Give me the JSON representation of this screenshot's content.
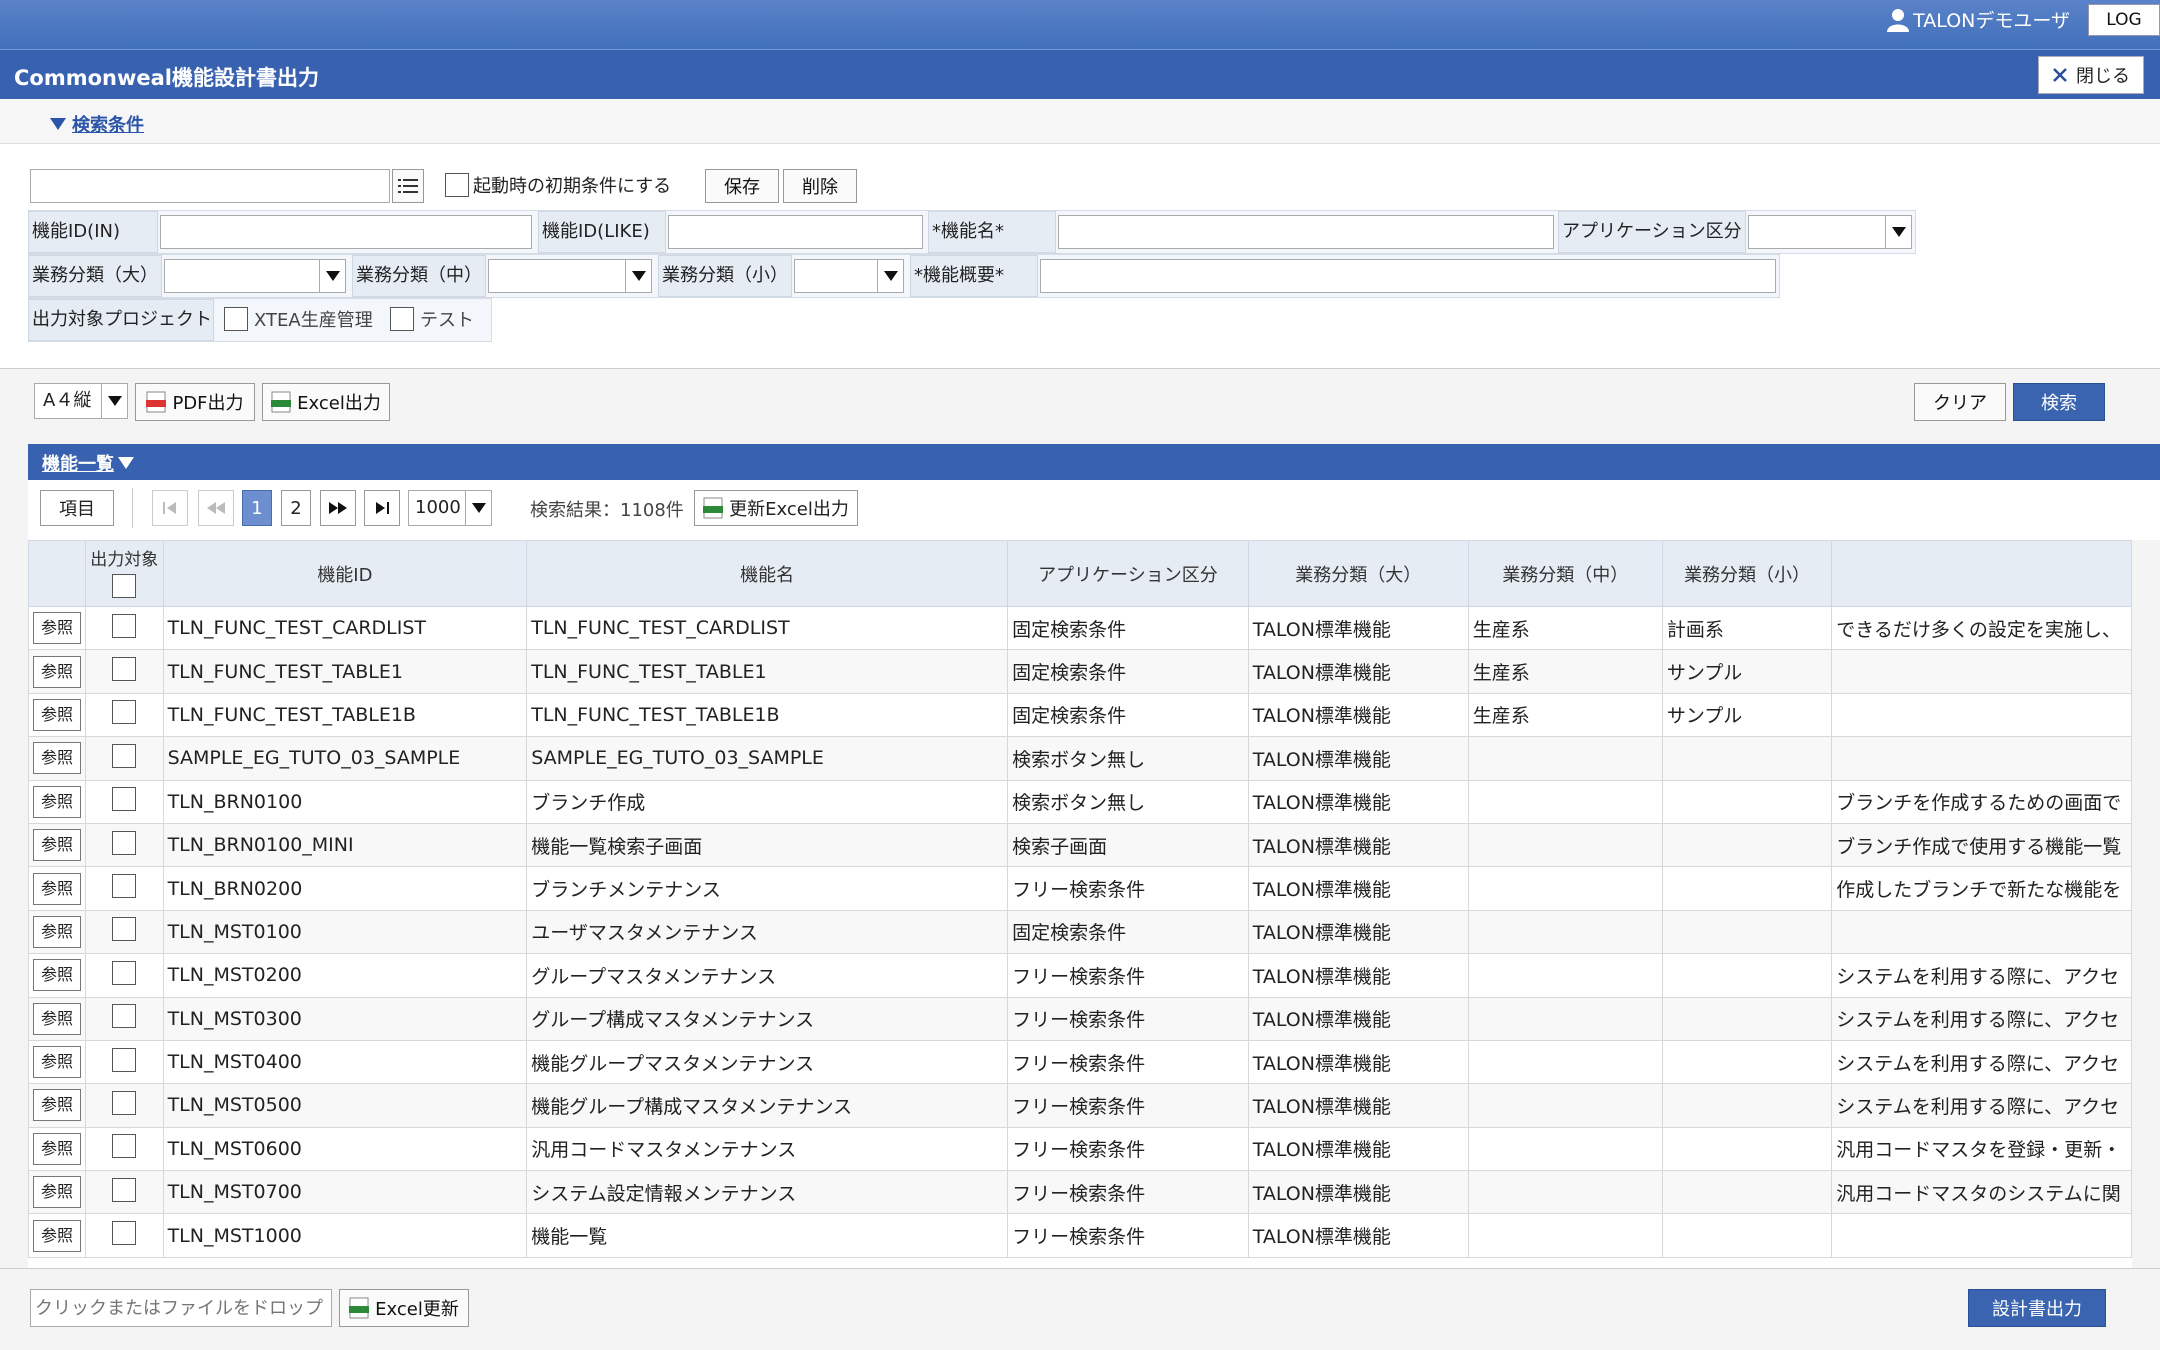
{
  "header": {
    "user_name": "TALONデモユーザ",
    "log_label": "LOG"
  },
  "window": {
    "title": "Commonweal機能設計書出力",
    "close_label": "閉じる"
  },
  "search_conditions": {
    "toggle_label": "検索条件",
    "preset_value": "",
    "initial_condition_label": "起動時の初期条件にする",
    "save_label": "保存",
    "delete_label": "削除",
    "fields": {
      "func_id_in": "機能ID(IN)",
      "func_id_like": "機能ID(LIKE)",
      "func_name": "*機能名*",
      "app_category": "アプリケーション区分",
      "biz_large": "業務分類（大）",
      "biz_medium": "業務分類（中）",
      "biz_small": "業務分類（小）",
      "func_summary": "*機能概要*",
      "output_project": "出力対象プロジェクト"
    },
    "projects": [
      "XTEA生産管理",
      "テスト"
    ]
  },
  "toolbar": {
    "paper_size": "A４縦",
    "pdf_label": "PDF出力",
    "excel_label": "Excel出力",
    "clear_label": "クリア",
    "search_label": "検索"
  },
  "list": {
    "title": "機能一覧",
    "items_label": "項目",
    "pages": [
      "1",
      "2"
    ],
    "page_size": "1000",
    "result_text": "検索結果：1108件",
    "update_excel_label": "更新Excel出力",
    "columns": {
      "output_target": "出力対象",
      "func_id": "機能ID",
      "func_name": "機能名",
      "app_category": "アプリケーション区分",
      "biz_large": "業務分類（大）",
      "biz_medium": "業務分類（中）",
      "biz_small": "業務分類（小）"
    },
    "ref_label": "参照",
    "rows": [
      [
        "TLN_FUNC_TEST_CARDLIST",
        "TLN_FUNC_TEST_CARDLIST",
        "固定検索条件",
        "TALON標準機能",
        "生産系",
        "計画系",
        "できるだけ多くの設定を実施し、"
      ],
      [
        "TLN_FUNC_TEST_TABLE1",
        "TLN_FUNC_TEST_TABLE1",
        "固定検索条件",
        "TALON標準機能",
        "生産系",
        "サンプル",
        ""
      ],
      [
        "TLN_FUNC_TEST_TABLE1B",
        "TLN_FUNC_TEST_TABLE1B",
        "固定検索条件",
        "TALON標準機能",
        "生産系",
        "サンプル",
        ""
      ],
      [
        "SAMPLE_EG_TUTO_03_SAMPLE",
        "SAMPLE_EG_TUTO_03_SAMPLE",
        "検索ボタン無し",
        "TALON標準機能",
        "",
        "",
        ""
      ],
      [
        "TLN_BRN0100",
        "ブランチ作成",
        "検索ボタン無し",
        "TALON標準機能",
        "",
        "",
        "ブランチを作成するための画面で"
      ],
      [
        "TLN_BRN0100_MINI",
        "機能一覧検索子画面",
        "検索子画面",
        "TALON標準機能",
        "",
        "",
        "ブランチ作成で使用する機能一覧"
      ],
      [
        "TLN_BRN0200",
        "ブランチメンテナンス",
        "フリー検索条件",
        "TALON標準機能",
        "",
        "",
        "作成したブランチで新たな機能を"
      ],
      [
        "TLN_MST0100",
        "ユーザマスタメンテナンス",
        "固定検索条件",
        "TALON標準機能",
        "",
        "",
        ""
      ],
      [
        "TLN_MST0200",
        "グループマスタメンテナンス",
        "フリー検索条件",
        "TALON標準機能",
        "",
        "",
        "システムを利用する際に、アクセ"
      ],
      [
        "TLN_MST0300",
        "グループ構成マスタメンテナンス",
        "フリー検索条件",
        "TALON標準機能",
        "",
        "",
        "システムを利用する際に、アクセ"
      ],
      [
        "TLN_MST0400",
        "機能グループマスタメンテナンス",
        "フリー検索条件",
        "TALON標準機能",
        "",
        "",
        "システムを利用する際に、アクセ"
      ],
      [
        "TLN_MST0500",
        "機能グループ構成マスタメンテナンス",
        "フリー検索条件",
        "TALON標準機能",
        "",
        "",
        "システムを利用する際に、アクセ"
      ],
      [
        "TLN_MST0600",
        "汎用コードマスタメンテナンス",
        "フリー検索条件",
        "TALON標準機能",
        "",
        "",
        "汎用コードマスタを登録・更新・"
      ],
      [
        "TLN_MST0700",
        "システム設定情報メンテナンス",
        "フリー検索条件",
        "TALON標準機能",
        "",
        "",
        "汎用コードマスタのシステムに関"
      ],
      [
        "TLN_MST1000",
        "機能一覧",
        "フリー検索条件",
        "TALON標準機能",
        "",
        "",
        ""
      ]
    ]
  },
  "footer": {
    "file_drop_placeholder": "クリックまたはファイルをドロップ",
    "excel_update_label": "Excel更新",
    "design_output_label": "設計書出力"
  },
  "colors": {
    "header_blue": "#3862b0",
    "primary_button": "#3a63b0",
    "label_bg": "#e6ecf4"
  }
}
